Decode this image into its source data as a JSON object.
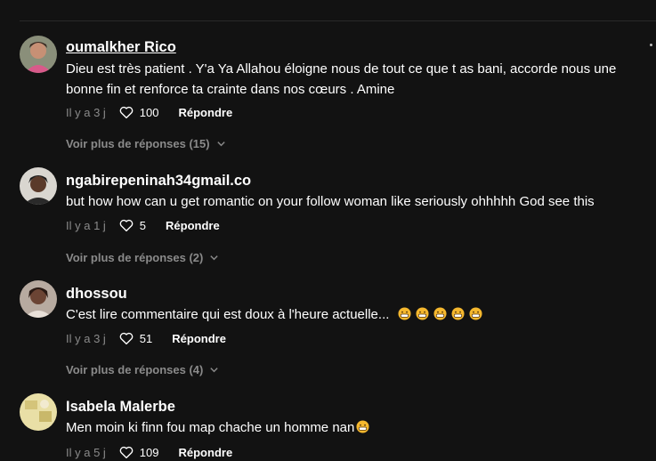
{
  "comments": [
    {
      "username": "oumalkher Rico",
      "text": "Dieu est très patient . Y'a Ya Allahou éloigne nous de tout ce que t as bani, accorde nous une bonne fin et renforce ta crainte dans nos cœurs . Amine",
      "time": "Il y a 3 j",
      "likes": "100",
      "reply_label": "Répondre",
      "more_replies": "Voir plus de réponses (15)"
    },
    {
      "username": "ngabirepeninah34gmail.co",
      "text": "but how how can u get romantic on your follow woman like seriously ohhhhh God see this",
      "time": "Il y a 1 j",
      "likes": "5",
      "reply_label": "Répondre",
      "more_replies": "Voir plus de réponses (2)"
    },
    {
      "username": "dhossou",
      "text": "C'est lire commentaire qui est doux à l'heure actuelle...",
      "time": "Il y a 3 j",
      "likes": "51",
      "reply_label": "Répondre",
      "more_replies": "Voir plus de réponses (4)"
    },
    {
      "username": "Isabela Malerbe",
      "text": "Men moin ki finn fou map chache un homme nan",
      "time": "Il y a 5 j",
      "likes": "109",
      "reply_label": "Répondre"
    }
  ],
  "icons": {
    "like": "heart-outline-icon",
    "expand": "chevron-down-icon",
    "emoji": "grinning-face-emoji",
    "menu": "more-dots-icon"
  },
  "colors": {
    "background": "#121212",
    "muted_text": "#8a8a8a",
    "emoji": "#f5b82e"
  }
}
